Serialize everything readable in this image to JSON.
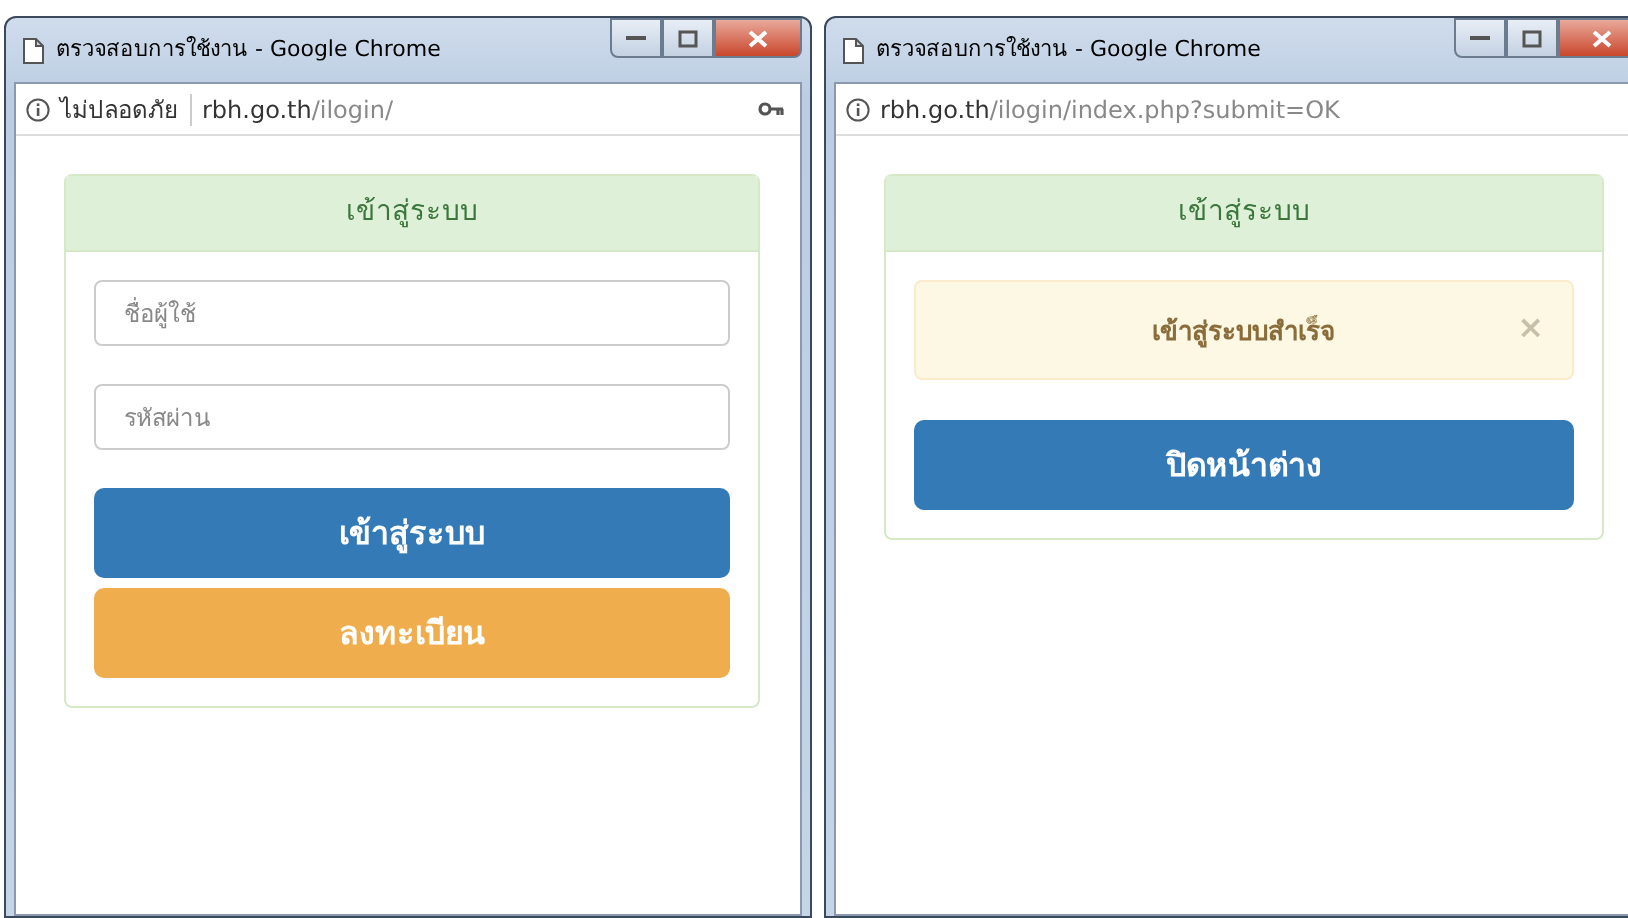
{
  "windows": [
    {
      "title": "ตรวจสอบการใช้งาน - Google Chrome",
      "address": {
        "security_label": "ไม่ปลอดภัย",
        "host": "rbh.go.th",
        "path": "/ilogin/",
        "saved_password": true
      },
      "card": {
        "header": "เข้าสู่ระบบ",
        "items": [
          {
            "kind": "field",
            "placeholder": "ชื่อผู้ใช้"
          },
          {
            "kind": "field",
            "placeholder": "รหัสผ่าน"
          },
          {
            "kind": "primary_button",
            "label": "เข้าสู่ระบบ"
          },
          {
            "kind": "warning_button",
            "label": "ลงทะเบียน"
          }
        ]
      }
    },
    {
      "title": "ตรวจสอบการใช้งาน - Google Chrome",
      "address": {
        "host": "rbh.go.th",
        "path": "/ilogin/index.php?submit=OK"
      },
      "card": {
        "header": "เข้าสู่ระบบ",
        "items": [
          {
            "kind": "alert",
            "text": "เข้าสู่ระบบสำเร็จ",
            "close_label": "×"
          },
          {
            "kind": "primary_button",
            "label": "ปิดหน้าต่าง"
          }
        ]
      }
    }
  ]
}
